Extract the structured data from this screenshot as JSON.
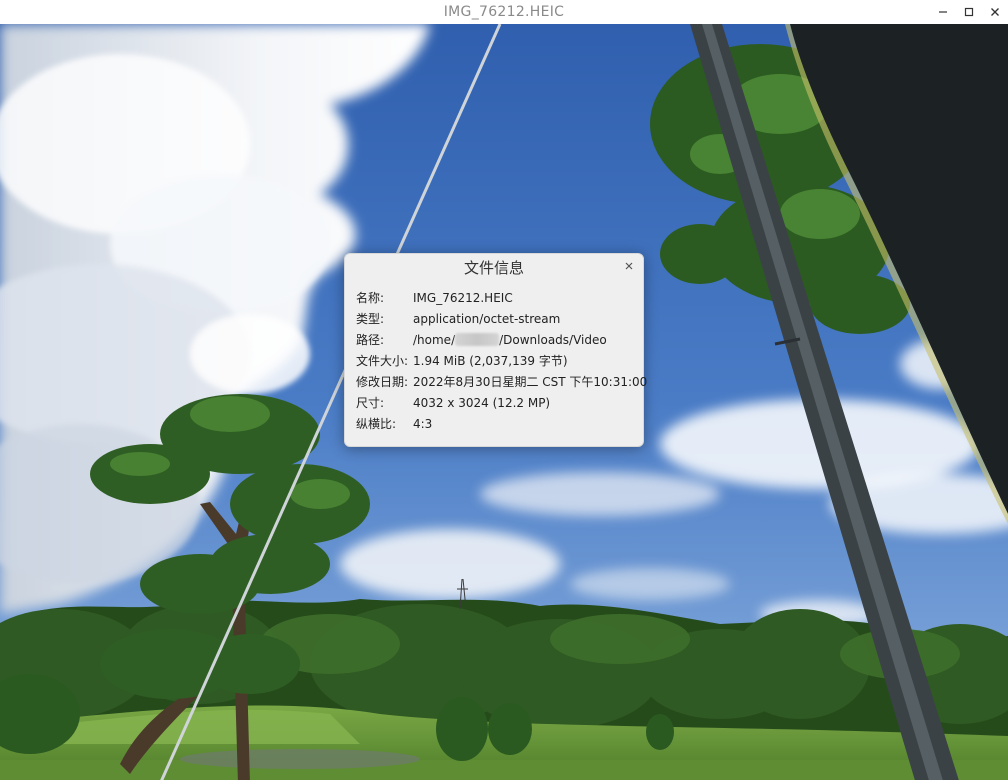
{
  "window": {
    "title": "IMG_76212.HEIC",
    "controls": {
      "minimize": "−",
      "maximize": "□",
      "close": "×"
    }
  },
  "dialog": {
    "title": "文件信息",
    "close_symbol": "×",
    "rows": [
      {
        "label": "名称:",
        "value": "IMG_76212.HEIC"
      },
      {
        "label": "类型:",
        "value": "application/octet-stream"
      },
      {
        "label": "路径:",
        "value_prefix": "/home/",
        "value_suffix": "/Downloads/Video",
        "redacted": true
      },
      {
        "label": "文件大小:",
        "value": "1.94 MiB (2,037,139 字节)"
      },
      {
        "label": "修改日期:",
        "value": "2022年8月30日星期二 CST 下午10:31:00"
      },
      {
        "label": "尺寸:",
        "value": "4032 x 3024 (12.2 MP)"
      },
      {
        "label": "纵横比:",
        "value": "4:3"
      }
    ]
  },
  "colors": {
    "sky": "#3f6fb8",
    "cloud": "#eef1f6",
    "tree_foliage": "#2f5a23",
    "grass": "#6c9a3a",
    "tent": "#1e2326",
    "pole": "#3b4246",
    "dialog_bg": "#efefef"
  }
}
